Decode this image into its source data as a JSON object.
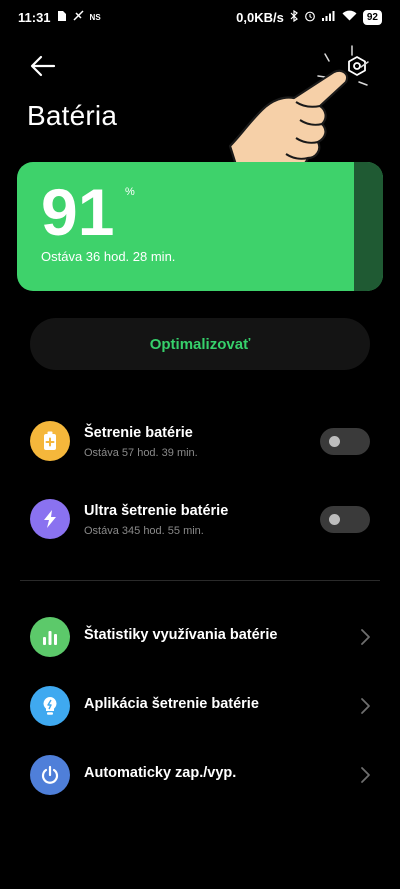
{
  "status_bar": {
    "time": "11:31",
    "left_icons": [
      "sim-card-icon",
      "no-signal-icon",
      "ns-icon"
    ],
    "ns_label": "NS",
    "speed": "0,0KB/s",
    "right_icons": [
      "bluetooth-icon",
      "alarm-icon",
      "signal-icon",
      "wifi-icon"
    ],
    "battery": "92"
  },
  "header": {
    "title": "Batéria"
  },
  "battery_card": {
    "level": "91",
    "unit": "%",
    "remaining": "Ostáva 36 hod. 28 min.",
    "level_fraction": 0.91,
    "color": "#3ed26b"
  },
  "optimize": {
    "label": "Optimalizovať"
  },
  "modes": [
    {
      "label": "Šetrenie batérie",
      "sub": "Ostáva 57 hod. 39 min.",
      "icon": "battery-plus-icon",
      "icon_color": "#f5b73b",
      "enabled": false
    },
    {
      "label": "Ultra šetrenie batérie",
      "sub": "Ostáva 345 hod. 55 min.",
      "icon": "lightning-icon",
      "icon_color": "#8a72f0",
      "enabled": false
    }
  ],
  "links": [
    {
      "label": "Štatistiky využívania batérie",
      "icon": "bar-chart-icon",
      "icon_color": "#5cc96a"
    },
    {
      "label": "Aplikácia šetrenie batérie",
      "icon": "lightbulb-icon",
      "icon_color": "#3fa9f0"
    },
    {
      "label": "Automaticky zap./vyp.",
      "icon": "power-icon",
      "icon_color": "#4f7fd9"
    }
  ]
}
